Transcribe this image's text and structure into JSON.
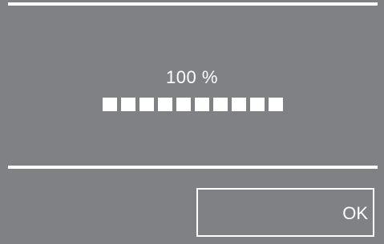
{
  "dialog": {
    "progress_text": "100 %",
    "progress": {
      "value_percent": 100,
      "segments_total": 10,
      "segments_filled": 10
    },
    "ok_label": "OK"
  },
  "colors": {
    "background": "#808184",
    "foreground": "#ffffff"
  }
}
